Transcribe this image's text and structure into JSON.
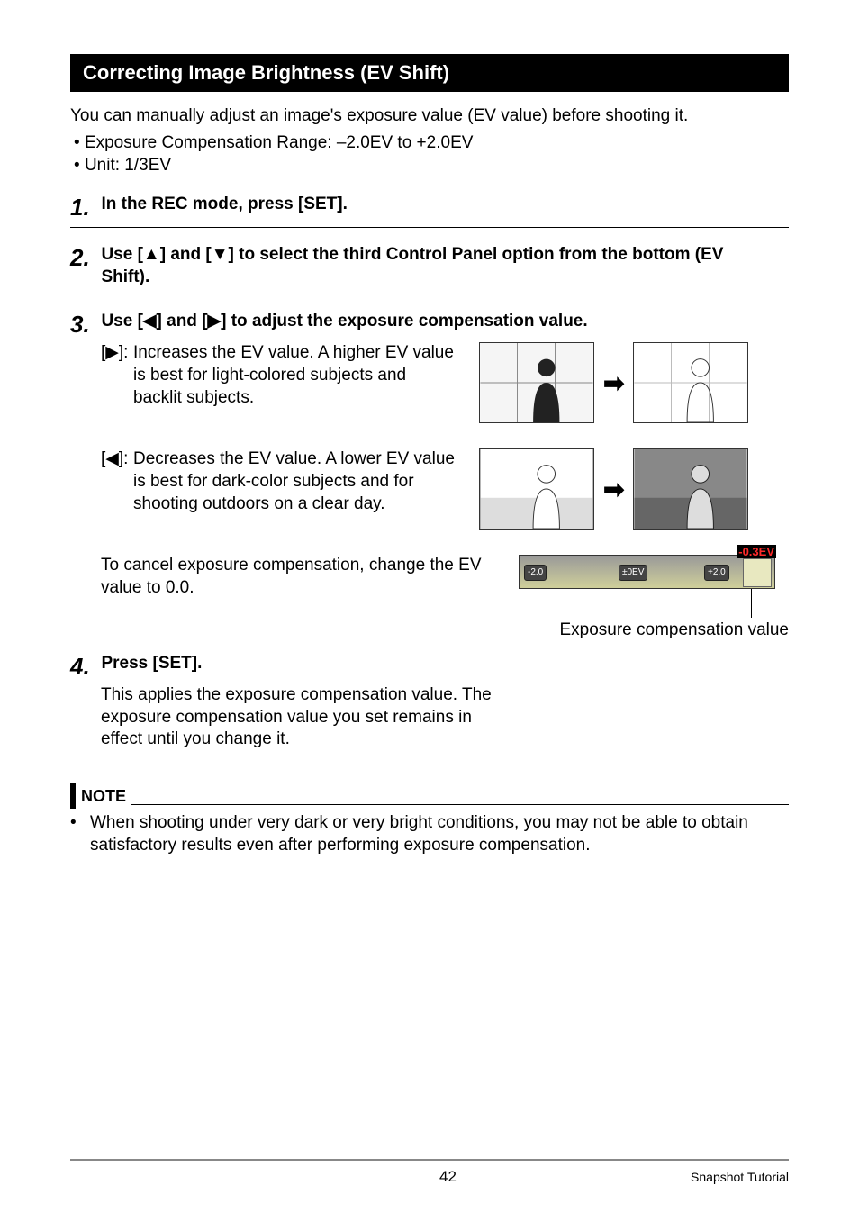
{
  "section_title": "Correcting Image Brightness (EV Shift)",
  "intro": "You can manually adjust an image's exposure value (EV value) before shooting it.",
  "intro_bullets": [
    "Exposure Compensation Range: –2.0EV to +2.0EV",
    "Unit: 1/3EV"
  ],
  "steps": {
    "s1": {
      "num": "1.",
      "head": "In the REC mode, press [SET]."
    },
    "s2": {
      "num": "2.",
      "head": "Use [▲] and [▼] to select the third Control Panel option from the bottom (EV Shift)."
    },
    "s3": {
      "num": "3.",
      "head": "Use [◀] and [▶] to adjust the exposure compensation value.",
      "right": {
        "label": "[▶]:",
        "desc": "Increases the EV value. A higher EV value is best for light-colored subjects and backlit subjects."
      },
      "left": {
        "label": "[◀]:",
        "desc": "Decreases the EV value. A lower EV value is best for dark-color subjects and for shooting outdoors on a clear day."
      },
      "cancel": "To cancel exposure compensation, change the EV value to 0.0."
    },
    "s4": {
      "num": "4.",
      "head": "Press [SET].",
      "body": "This applies the exposure compensation value. The exposure compensation value you set remains in effect until you change it."
    }
  },
  "ev_bar": {
    "min": "-2.0",
    "mid": "±0EV",
    "max": "+2.0",
    "callout": "-0.3EV",
    "caption": "Exposure compensation value"
  },
  "note": {
    "title": "NOTE",
    "item": "When shooting under very dark or very bright conditions, you may not be able to obtain satisfactory results even after performing exposure compensation."
  },
  "footer": {
    "page": "42",
    "label": "Snapshot Tutorial"
  }
}
